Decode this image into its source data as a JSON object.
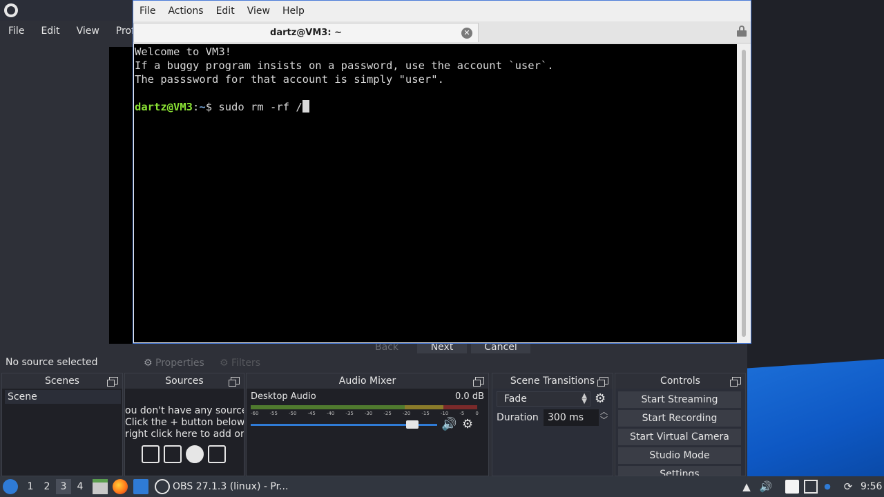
{
  "obs": {
    "menu": [
      "File",
      "Edit",
      "View",
      "Profi"
    ],
    "wizard": {
      "back": "Back",
      "next": "Next",
      "cancel": "Cancel"
    },
    "no_source": "No source selected",
    "properties": "Properties",
    "filters": "Filters",
    "docks": {
      "scenes": {
        "title": "Scenes",
        "items": [
          "Scene"
        ]
      },
      "sources": {
        "title": "Sources",
        "message": [
          "ou don't have any sources",
          "Click the + button below,",
          "right click here to add or"
        ]
      },
      "mixer": {
        "title": "Audio Mixer",
        "device": "Desktop Audio",
        "level": "0.0 dB",
        "ticks": [
          "-60",
          "-55",
          "-50",
          "-45",
          "-40",
          "-35",
          "-30",
          "-25",
          "-20",
          "-15",
          "-10",
          "-5",
          "0"
        ],
        "volume": 0.9
      },
      "transitions": {
        "title": "Scene Transitions",
        "selected": "Fade",
        "duration_label": "Duration",
        "duration_value": "300 ms"
      },
      "controls": {
        "title": "Controls",
        "buttons": [
          "Start Streaming",
          "Start Recording",
          "Start Virtual Camera",
          "Studio Mode",
          "Settings"
        ]
      }
    }
  },
  "terminal": {
    "menu": [
      "File",
      "Actions",
      "Edit",
      "View",
      "Help"
    ],
    "tab_title": "dartz@VM3: ~",
    "lines": [
      "Welcome to VM3!",
      "If a buggy program insists on a password, use the account `user`.",
      "The passsword for that account is simply \"user\".",
      ""
    ],
    "prompt_user": "dartz@VM3",
    "prompt_sep": ":",
    "prompt_path": "~",
    "prompt_end": "$ ",
    "command": "sudo rm -rf /"
  },
  "taskbar": {
    "workspaces": [
      "1",
      "2",
      "3",
      "4"
    ],
    "active_workspace": "3",
    "task_obs": "OBS 27.1.3 (linux) - Pr...",
    "clock": "9:56"
  },
  "colors": {
    "prompt_user": "#8ae234",
    "prompt_path": "#729fcf",
    "accent": "#2f7bd6"
  }
}
